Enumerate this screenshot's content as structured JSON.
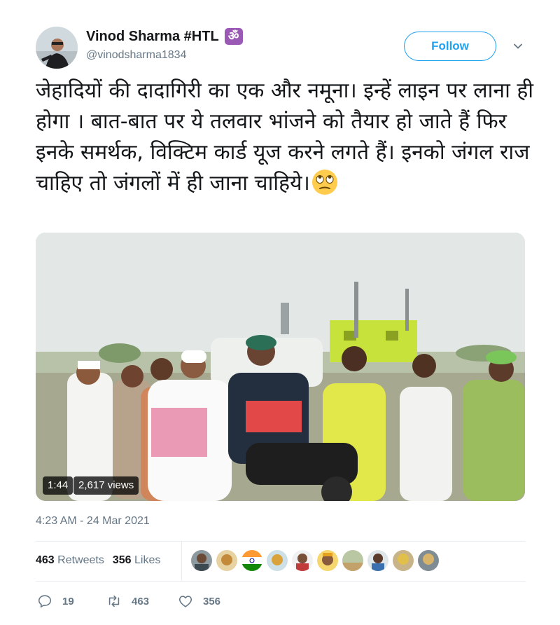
{
  "user": {
    "display_name": "Vinod Sharma #HTL",
    "badge_symbol": "ॐ",
    "handle": "@vinodsharma1834"
  },
  "follow_label": "Follow",
  "tweet": {
    "text": "जेहादियों की दादागिरी का एक और नमूना। इन्हें लाइन पर लाना ही होगा । बात-बात पर ये तलवार भांजने को तैयार हो जाते हैं फिर इनके समर्थक, विक्टिम कार्ड यूज करने लगते हैं। इनको जंगल राज चाहिए तो जंगलों में ही जाना चाहिये।",
    "emoji": "face-with-rolling-eyes"
  },
  "video": {
    "duration": "1:44",
    "views": "2,617 views"
  },
  "timestamp": "4:23 AM - 24 Mar 2021",
  "stats": {
    "retweets_count": "463",
    "retweets_label": "Retweets",
    "likes_count": "356",
    "likes_label": "Likes"
  },
  "actions": {
    "reply_count": "19",
    "retweet_count": "463",
    "like_count": "356"
  },
  "colors": {
    "accent": "#1da1f2",
    "text": "#14171a",
    "muted": "#657786",
    "badge": "#9b59b6"
  }
}
